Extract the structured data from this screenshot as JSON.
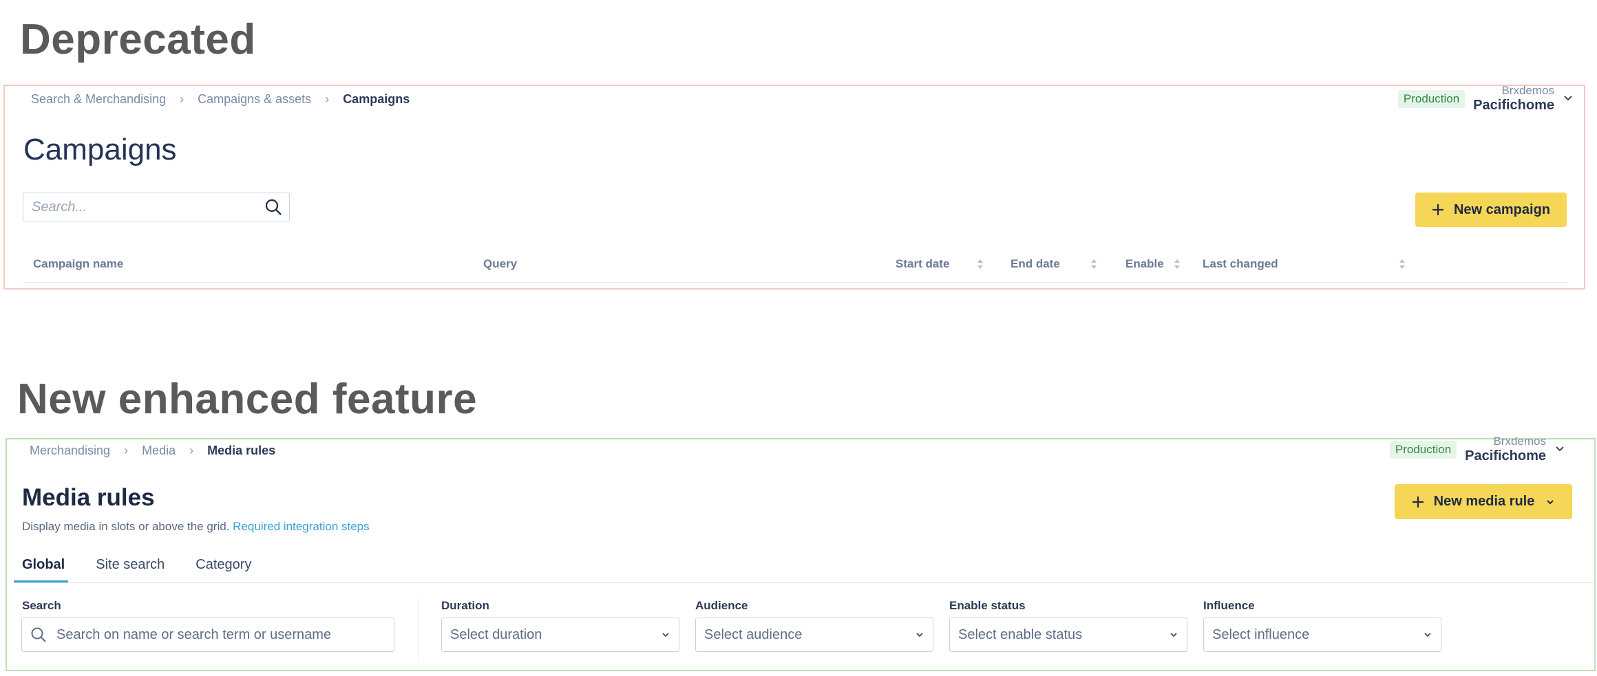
{
  "sections": {
    "deprecated_title": "Deprecated",
    "new_title": "New enhanced feature"
  },
  "deprecated": {
    "breadcrumb": [
      "Search & Merchandising",
      "Campaigns & assets",
      "Campaigns"
    ],
    "environment": "Production",
    "account": {
      "org": "Brxdemos",
      "site": "Pacifichome"
    },
    "page_title": "Campaigns",
    "search_placeholder": "Search...",
    "new_button": "New campaign",
    "columns": [
      "Campaign name",
      "Query",
      "Start date",
      "End date",
      "Enable",
      "Last changed"
    ]
  },
  "enhanced": {
    "breadcrumb": [
      "Merchandising",
      "Media",
      "Media rules"
    ],
    "environment": "Production",
    "account": {
      "org": "Brxdemos",
      "site": "Pacifichome"
    },
    "page_title": "Media rules",
    "subtitle": "Display media in slots or above the grid.",
    "subtitle_link": "Required integration steps",
    "new_button": "New media rule",
    "tabs": [
      "Global",
      "Site search",
      "Category"
    ],
    "active_tab": "Global",
    "filters": {
      "search": {
        "label": "Search",
        "placeholder": "Search on name or search term or username"
      },
      "duration": {
        "label": "Duration",
        "placeholder": "Select duration"
      },
      "audience": {
        "label": "Audience",
        "placeholder": "Select audience"
      },
      "enable_status": {
        "label": "Enable status",
        "placeholder": "Select enable status"
      },
      "influence": {
        "label": "Influence",
        "placeholder": "Select influence"
      }
    }
  },
  "colors": {
    "accent_yellow": "#f5d656",
    "link_blue": "#3a9fd6",
    "production_green": "#2f8a46",
    "deprecated_frame": "#f1c9c4",
    "new_frame": "#bfe0b5"
  }
}
